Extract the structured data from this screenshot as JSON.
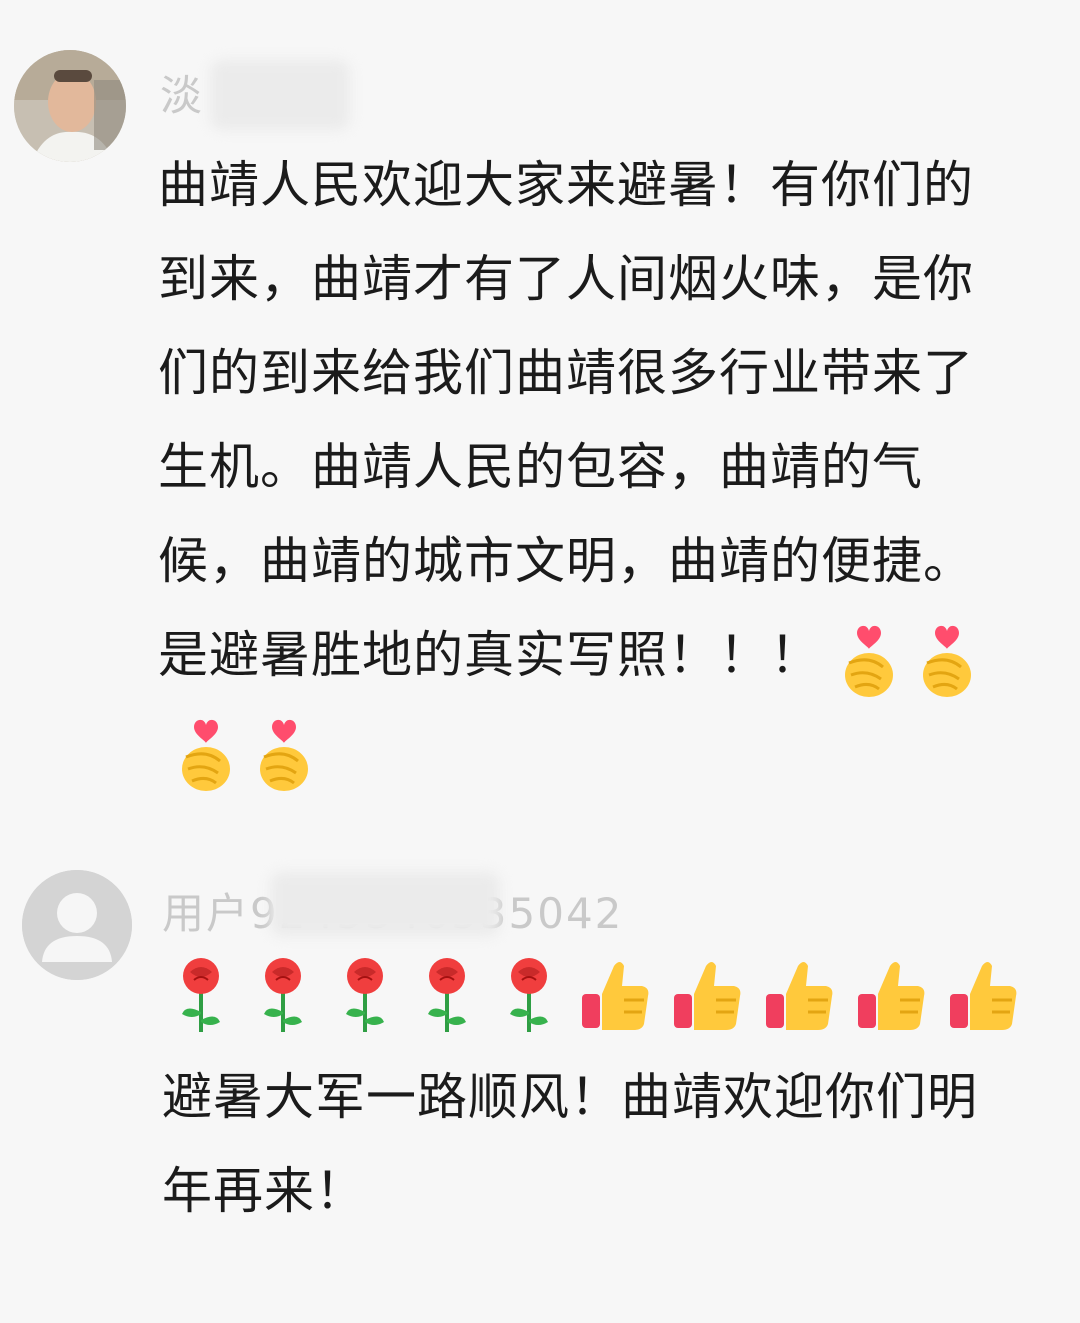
{
  "comments": [
    {
      "username": "淡 泊",
      "text": "曲靖人民欢迎大家来避暑！有你们的到来，曲靖才有了人间烟火味，是你们的到来给我们曲靖很多行业带来了生机。曲靖人民的包容，曲靖的气候，曲靖的城市文明，曲靖的便捷。是避暑胜地的真实写照！！！",
      "trailing_emojis": [
        "heart-hand",
        "heart-hand",
        "heart-hand",
        "heart-hand"
      ]
    },
    {
      "username": "用户9245346535042",
      "emoji_row": [
        "rose",
        "rose",
        "rose",
        "rose",
        "rose",
        "thumbs-up",
        "thumbs-up",
        "thumbs-up",
        "thumbs-up",
        "thumbs-up"
      ],
      "text": "避暑大军一路顺风！曲靖欢迎你们明年再来！"
    }
  ],
  "colors": {
    "background": "#f7f7f7",
    "text": "#1b1b1b",
    "username": "#c9c9c9"
  }
}
